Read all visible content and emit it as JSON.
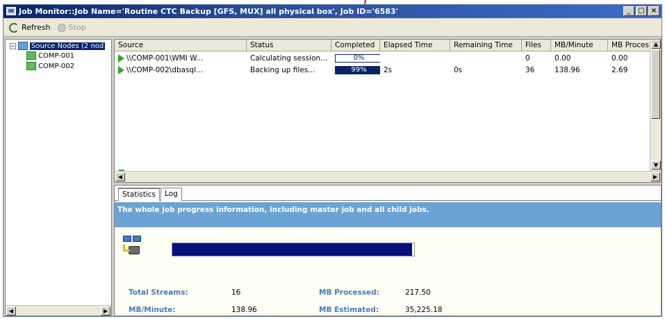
{
  "window": {
    "title": "Job Monitor::Job Name='Routine CTC Backup [GFS, MUX] all physical box', Job ID='6583'"
  },
  "toolbar": {
    "refresh_label": "Refresh",
    "stop_label": "Stop"
  },
  "tree": {
    "root_label": "Source Nodes (2 nod",
    "children": [
      "COMP-001",
      "COMP-002"
    ]
  },
  "grid": {
    "columns": [
      "Source",
      "Status",
      "Completed",
      "Elapsed Time",
      "Remaining Time",
      "Files",
      "MB/Minute",
      "MB Proces"
    ],
    "rows": [
      {
        "source": "\\\\COMP-001\\WMI W...",
        "status": "Calculating session...",
        "completed_label": "0%",
        "completed": 0,
        "elapsed": "",
        "remaining": "",
        "files": "0",
        "mb_minute": "0.00",
        "mb_processed": "0.00"
      },
      {
        "source": "\\\\COMP-002\\dbasql...",
        "status": "Backing up files...",
        "completed_label": "99%",
        "completed": 99,
        "elapsed": "2s",
        "remaining": "0s",
        "files": "36",
        "mb_minute": "138.96",
        "mb_processed": "2.69"
      }
    ]
  },
  "tabs": {
    "statistics": "Statistics",
    "log": "Log"
  },
  "info": {
    "banner": "The whole job progress information, including master job and all child jobs."
  },
  "overall_progress": 99,
  "stats": {
    "total_streams_label": "Total Streams:",
    "total_streams": "16",
    "mb_minute_label": "MB/Minute:",
    "mb_minute": "138.96",
    "mb_processed_label": "MB Processed:",
    "mb_processed": "217.50",
    "mb_estimated_label": "MB Estimated:",
    "mb_estimated": "35,225.18"
  },
  "colors": {
    "title_bar": "#0a246a",
    "progress": "#0a107a",
    "banner": "#6ba3d4",
    "stat_label": "#4a7ab8",
    "annotation": "#e01010"
  }
}
